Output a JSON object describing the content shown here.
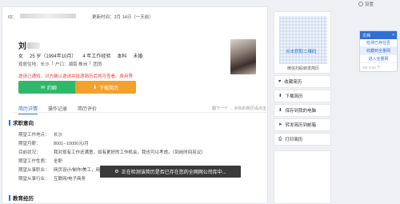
{
  "topbar": {
    "settings_label": "设置"
  },
  "resume": {
    "id_label": "ID：",
    "update_time": "更新时间：2月 14日（一天前）",
    "name_surname": "刘",
    "gender": "女",
    "age": "25 岁（1994年10月）",
    "experience": "4 年工作经验",
    "education": "本科",
    "marital": "未婚",
    "address_line": [
      "现居住地：长沙",
      "|",
      "户口：湖南 株洲",
      "|",
      "团员"
    ],
    "notice": "邀请已通知，对方确认邀请并投递简历后将可查看。费用等"
  },
  "buttons": {
    "chat": "约聊",
    "download": "下载简历"
  },
  "tabs": [
    "简历详情",
    "操作记录",
    "简历评价"
  ],
  "pager": "翻下一个 →  对标的简历请点击",
  "sections": {
    "intention_title": "求职意向",
    "intention_rows": [
      {
        "k": "期望工作地点：",
        "v": "长沙"
      },
      {
        "k": "期望月薪：",
        "v": "8001--10000元/月"
      },
      {
        "k": "目前状况：",
        "v": "我对现有工作还满意，如有更好的工作机会，我也可以考虑。（到岗时间另议）"
      },
      {
        "k": "期望工作性质：",
        "v": "全职"
      },
      {
        "k": "期望从事职业：",
        "v": "网页设计/制作/美工，用户界面（UI）设计，用户体验（UE/UX）设计"
      },
      {
        "k": "期望从事行业：",
        "v": "互联网/电子商务"
      }
    ],
    "education_title": "教育经历"
  },
  "toast": "正在检测该简历是否已存在您的全网网公司库中...",
  "qr": {
    "label": "点击获取二维码",
    "caption": "微信扫码转发简历"
  },
  "actions": [
    "收藏简历",
    "下载简历",
    "保存到我的电脑",
    "转发简历到邮箱",
    "打印简历"
  ],
  "widget": {
    "title": "文档",
    "items": [
      "检测已存在否",
      "收藏到全量网",
      "进入全量网"
    ],
    "version": "Ver 0.54"
  }
}
